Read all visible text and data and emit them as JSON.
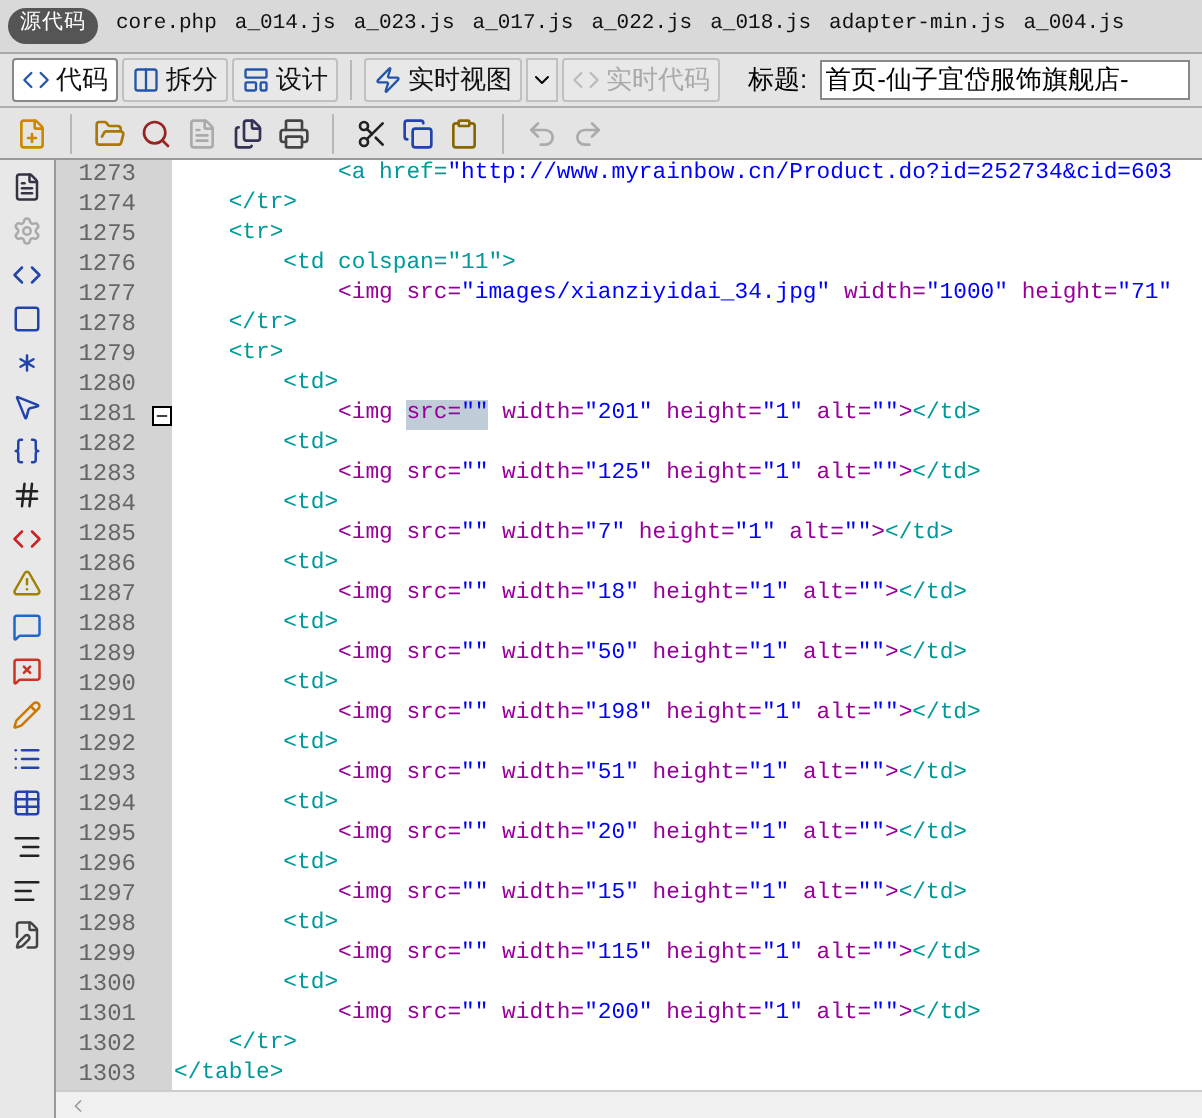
{
  "document_tabs": [
    {
      "label": "源代码",
      "selected": true
    },
    {
      "label": "core.php",
      "selected": false
    },
    {
      "label": "a_014.js",
      "selected": false
    },
    {
      "label": "a_023.js",
      "selected": false
    },
    {
      "label": "a_017.js",
      "selected": false
    },
    {
      "label": "a_022.js",
      "selected": false
    },
    {
      "label": "a_018.js",
      "selected": false
    },
    {
      "label": "adapter-min.js",
      "selected": false
    },
    {
      "label": "a_004.js",
      "selected": false
    }
  ],
  "view_buttons": [
    {
      "label": "代码",
      "kind": "code",
      "selected": true,
      "disabled": false
    },
    {
      "label": "拆分",
      "kind": "split",
      "selected": false,
      "disabled": false
    },
    {
      "label": "设计",
      "kind": "design",
      "selected": false,
      "disabled": false
    },
    {
      "label": "实时视图",
      "kind": "live",
      "selected": false,
      "disabled": false
    },
    {
      "label": "实时代码",
      "kind": "livecode",
      "selected": false,
      "disabled": true
    }
  ],
  "title_field": {
    "label": "标题:",
    "value": "首页-仙子宜岱服饰旗舰店-"
  },
  "code_lines": [
    {
      "number": "1273",
      "fold": false,
      "tokens": [
        {
          "kind": "tag",
          "text": "            <a href="
        },
        {
          "kind": "value",
          "text": "\"http://www.myrainbow.cn/Product.do?id=252734&cid=603"
        }
      ]
    },
    {
      "number": "1274",
      "fold": false,
      "tokens": [
        {
          "kind": "tag",
          "text": "    </tr>"
        }
      ]
    },
    {
      "number": "1275",
      "fold": false,
      "tokens": [
        {
          "kind": "tag",
          "text": "    <tr>"
        }
      ]
    },
    {
      "number": "1276",
      "fold": false,
      "tokens": [
        {
          "kind": "tag",
          "text": "        <td colspan=\"11\">"
        }
      ]
    },
    {
      "number": "1277",
      "fold": false,
      "tokens": [
        {
          "kind": "attr",
          "text": "            <img src="
        },
        {
          "kind": "value",
          "text": "\"images/xianziyidai_34.jpg\""
        },
        {
          "kind": "attr",
          "text": " width="
        },
        {
          "kind": "value",
          "text": "\"1000\""
        },
        {
          "kind": "attr",
          "text": " height="
        },
        {
          "kind": "value",
          "text": "\"71\""
        }
      ]
    },
    {
      "number": "1278",
      "fold": false,
      "tokens": [
        {
          "kind": "tag",
          "text": "    </tr>"
        }
      ]
    },
    {
      "number": "1279",
      "fold": false,
      "tokens": [
        {
          "kind": "tag",
          "text": "    <tr>"
        }
      ]
    },
    {
      "number": "1280",
      "fold": false,
      "tokens": [
        {
          "kind": "tag",
          "text": "        <td>"
        }
      ]
    },
    {
      "number": "1281",
      "fold": true,
      "tokens": [
        {
          "kind": "attr",
          "text": "            <img "
        },
        {
          "kind": "attr",
          "text": "src=",
          "highlighted": true
        },
        {
          "kind": "value",
          "text": "\"\"",
          "highlighted": true
        },
        {
          "kind": "attr",
          "text": " width="
        },
        {
          "kind": "value",
          "text": "\"201\""
        },
        {
          "kind": "attr",
          "text": " height="
        },
        {
          "kind": "value",
          "text": "\"1\""
        },
        {
          "kind": "attr",
          "text": " alt="
        },
        {
          "kind": "value",
          "text": "\"\""
        },
        {
          "kind": "attr",
          "text": ">"
        },
        {
          "kind": "tag",
          "text": "</td>"
        }
      ]
    },
    {
      "number": "1282",
      "fold": false,
      "tokens": [
        {
          "kind": "tag",
          "text": "        <td>"
        }
      ]
    },
    {
      "number": "1283",
      "fold": false,
      "tokens": [
        {
          "kind": "attr",
          "text": "            <img src="
        },
        {
          "kind": "value",
          "text": "\"\""
        },
        {
          "kind": "attr",
          "text": " width="
        },
        {
          "kind": "value",
          "text": "\"125\""
        },
        {
          "kind": "attr",
          "text": " height="
        },
        {
          "kind": "value",
          "text": "\"1\""
        },
        {
          "kind": "attr",
          "text": " alt="
        },
        {
          "kind": "value",
          "text": "\"\""
        },
        {
          "kind": "attr",
          "text": ">"
        },
        {
          "kind": "tag",
          "text": "</td>"
        }
      ]
    },
    {
      "number": "1284",
      "fold": false,
      "tokens": [
        {
          "kind": "tag",
          "text": "        <td>"
        }
      ]
    },
    {
      "number": "1285",
      "fold": false,
      "tokens": [
        {
          "kind": "attr",
          "text": "            <img src="
        },
        {
          "kind": "value",
          "text": "\"\""
        },
        {
          "kind": "attr",
          "text": " width="
        },
        {
          "kind": "value",
          "text": "\"7\""
        },
        {
          "kind": "attr",
          "text": " height="
        },
        {
          "kind": "value",
          "text": "\"1\""
        },
        {
          "kind": "attr",
          "text": " alt="
        },
        {
          "kind": "value",
          "text": "\"\""
        },
        {
          "kind": "attr",
          "text": ">"
        },
        {
          "kind": "tag",
          "text": "</td>"
        }
      ]
    },
    {
      "number": "1286",
      "fold": false,
      "tokens": [
        {
          "kind": "tag",
          "text": "        <td>"
        }
      ]
    },
    {
      "number": "1287",
      "fold": false,
      "tokens": [
        {
          "kind": "attr",
          "text": "            <img src="
        },
        {
          "kind": "value",
          "text": "\"\""
        },
        {
          "kind": "attr",
          "text": " width="
        },
        {
          "kind": "value",
          "text": "\"18\""
        },
        {
          "kind": "attr",
          "text": " height="
        },
        {
          "kind": "value",
          "text": "\"1\""
        },
        {
          "kind": "attr",
          "text": " alt="
        },
        {
          "kind": "value",
          "text": "\"\""
        },
        {
          "kind": "attr",
          "text": ">"
        },
        {
          "kind": "tag",
          "text": "</td>"
        }
      ]
    },
    {
      "number": "1288",
      "fold": false,
      "tokens": [
        {
          "kind": "tag",
          "text": "        <td>"
        }
      ]
    },
    {
      "number": "1289",
      "fold": false,
      "tokens": [
        {
          "kind": "attr",
          "text": "            <img src="
        },
        {
          "kind": "value",
          "text": "\"\""
        },
        {
          "kind": "attr",
          "text": " width="
        },
        {
          "kind": "value",
          "text": "\"50\""
        },
        {
          "kind": "attr",
          "text": " height="
        },
        {
          "kind": "value",
          "text": "\"1\""
        },
        {
          "kind": "attr",
          "text": " alt="
        },
        {
          "kind": "value",
          "text": "\"\""
        },
        {
          "kind": "attr",
          "text": ">"
        },
        {
          "kind": "tag",
          "text": "</td>"
        }
      ]
    },
    {
      "number": "1290",
      "fold": false,
      "tokens": [
        {
          "kind": "tag",
          "text": "        <td>"
        }
      ]
    },
    {
      "number": "1291",
      "fold": false,
      "tokens": [
        {
          "kind": "attr",
          "text": "            <img src="
        },
        {
          "kind": "value",
          "text": "\"\""
        },
        {
          "kind": "attr",
          "text": " width="
        },
        {
          "kind": "value",
          "text": "\"198\""
        },
        {
          "kind": "attr",
          "text": " height="
        },
        {
          "kind": "value",
          "text": "\"1\""
        },
        {
          "kind": "attr",
          "text": " alt="
        },
        {
          "kind": "value",
          "text": "\"\""
        },
        {
          "kind": "attr",
          "text": ">"
        },
        {
          "kind": "tag",
          "text": "</td>"
        }
      ]
    },
    {
      "number": "1292",
      "fold": false,
      "tokens": [
        {
          "kind": "tag",
          "text": "        <td>"
        }
      ]
    },
    {
      "number": "1293",
      "fold": false,
      "tokens": [
        {
          "kind": "attr",
          "text": "            <img src="
        },
        {
          "kind": "value",
          "text": "\"\""
        },
        {
          "kind": "attr",
          "text": " width="
        },
        {
          "kind": "value",
          "text": "\"51\""
        },
        {
          "kind": "attr",
          "text": " height="
        },
        {
          "kind": "value",
          "text": "\"1\""
        },
        {
          "kind": "attr",
          "text": " alt="
        },
        {
          "kind": "value",
          "text": "\"\""
        },
        {
          "kind": "attr",
          "text": ">"
        },
        {
          "kind": "tag",
          "text": "</td>"
        }
      ]
    },
    {
      "number": "1294",
      "fold": false,
      "tokens": [
        {
          "kind": "tag",
          "text": "        <td>"
        }
      ]
    },
    {
      "number": "1295",
      "fold": false,
      "tokens": [
        {
          "kind": "attr",
          "text": "            <img src="
        },
        {
          "kind": "value",
          "text": "\"\""
        },
        {
          "kind": "attr",
          "text": " width="
        },
        {
          "kind": "value",
          "text": "\"20\""
        },
        {
          "kind": "attr",
          "text": " height="
        },
        {
          "kind": "value",
          "text": "\"1\""
        },
        {
          "kind": "attr",
          "text": " alt="
        },
        {
          "kind": "value",
          "text": "\"\""
        },
        {
          "kind": "attr",
          "text": ">"
        },
        {
          "kind": "tag",
          "text": "</td>"
        }
      ]
    },
    {
      "number": "1296",
      "fold": false,
      "tokens": [
        {
          "kind": "tag",
          "text": "        <td>"
        }
      ]
    },
    {
      "number": "1297",
      "fold": false,
      "tokens": [
        {
          "kind": "attr",
          "text": "            <img src="
        },
        {
          "kind": "value",
          "text": "\"\""
        },
        {
          "kind": "attr",
          "text": " width="
        },
        {
          "kind": "value",
          "text": "\"15\""
        },
        {
          "kind": "attr",
          "text": " height="
        },
        {
          "kind": "value",
          "text": "\"1\""
        },
        {
          "kind": "attr",
          "text": " alt="
        },
        {
          "kind": "value",
          "text": "\"\""
        },
        {
          "kind": "attr",
          "text": ">"
        },
        {
          "kind": "tag",
          "text": "</td>"
        }
      ]
    },
    {
      "number": "1298",
      "fold": false,
      "tokens": [
        {
          "kind": "tag",
          "text": "        <td>"
        }
      ]
    },
    {
      "number": "1299",
      "fold": false,
      "tokens": [
        {
          "kind": "attr",
          "text": "            <img src="
        },
        {
          "kind": "value",
          "text": "\"\""
        },
        {
          "kind": "attr",
          "text": " width="
        },
        {
          "kind": "value",
          "text": "\"115\""
        },
        {
          "kind": "attr",
          "text": " height="
        },
        {
          "kind": "value",
          "text": "\"1\""
        },
        {
          "kind": "attr",
          "text": " alt="
        },
        {
          "kind": "value",
          "text": "\"\""
        },
        {
          "kind": "attr",
          "text": ">"
        },
        {
          "kind": "tag",
          "text": "</td>"
        }
      ]
    },
    {
      "number": "1300",
      "fold": false,
      "tokens": [
        {
          "kind": "tag",
          "text": "        <td>"
        }
      ]
    },
    {
      "number": "1301",
      "fold": false,
      "tokens": [
        {
          "kind": "attr",
          "text": "            <img src="
        },
        {
          "kind": "value",
          "text": "\"\""
        },
        {
          "kind": "attr",
          "text": " width="
        },
        {
          "kind": "value",
          "text": "\"200\""
        },
        {
          "kind": "attr",
          "text": " height="
        },
        {
          "kind": "value",
          "text": "\"1\""
        },
        {
          "kind": "attr",
          "text": " alt="
        },
        {
          "kind": "value",
          "text": "\"\""
        },
        {
          "kind": "attr",
          "text": ">"
        },
        {
          "kind": "tag",
          "text": "</td>"
        }
      ]
    },
    {
      "number": "1302",
      "fold": false,
      "tokens": [
        {
          "kind": "tag",
          "text": "    </tr>"
        }
      ]
    },
    {
      "number": "1303",
      "fold": false,
      "tokens": [
        {
          "kind": "tag",
          "text": "</table>"
        }
      ]
    }
  ]
}
